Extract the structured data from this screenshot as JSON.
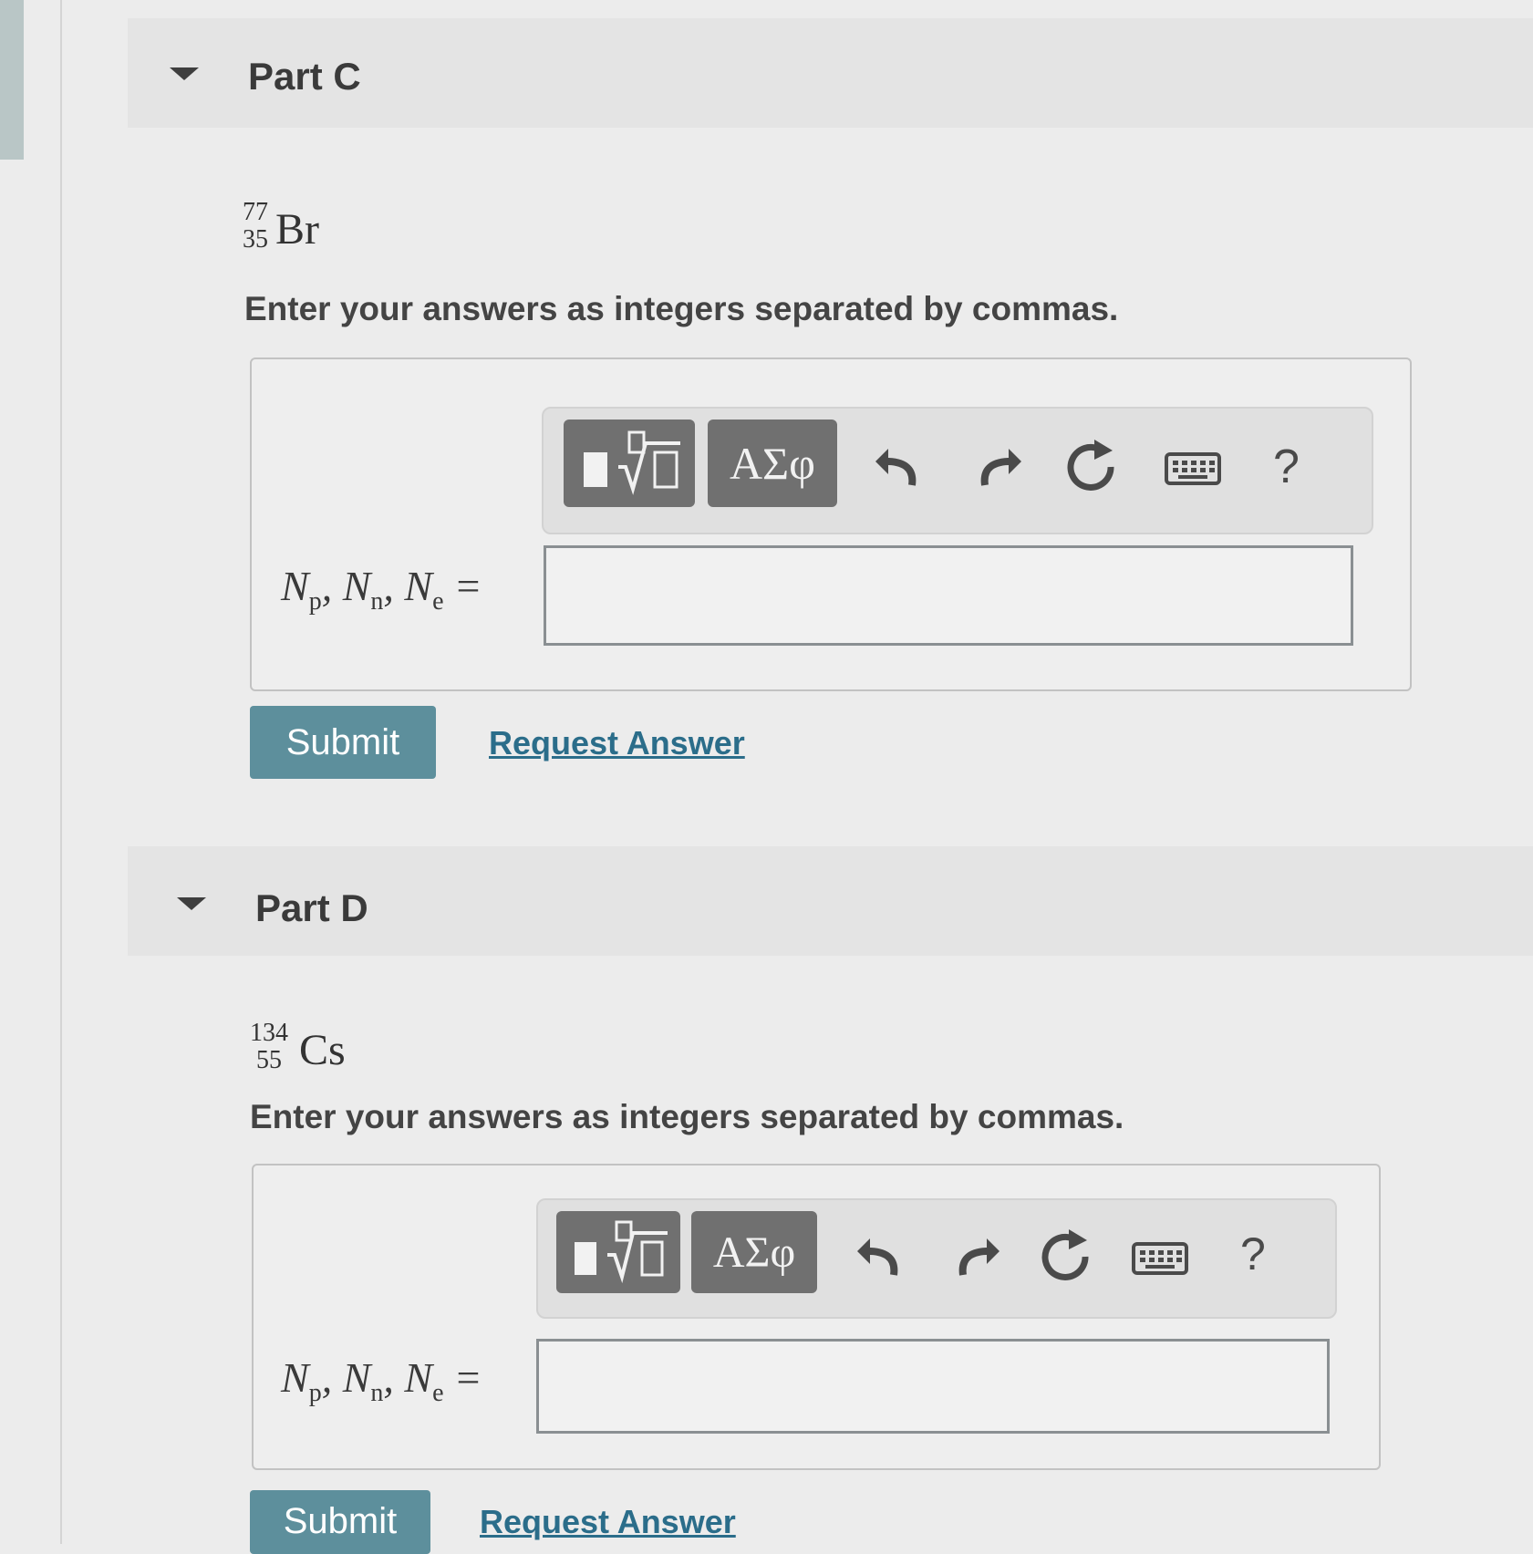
{
  "parts": [
    {
      "title": "Part C",
      "isotope": {
        "mass": "77",
        "atomic": "35",
        "symbol": "Br"
      },
      "instruction": "Enter your answers as integers separated by commas.",
      "toolbar": {
        "templates_icon": "templates-icon",
        "greek_label": "ΑΣφ",
        "help_label": "?"
      },
      "label": {
        "p": "p",
        "n": "n",
        "e": "e",
        "var": "N",
        "equals": "="
      },
      "input_value": "",
      "submit_label": "Submit",
      "request_label": "Request Answer"
    },
    {
      "title": "Part D",
      "isotope": {
        "mass": "134",
        "atomic": "55",
        "symbol": "Cs"
      },
      "instruction": "Enter your answers as integers separated by commas.",
      "toolbar": {
        "templates_icon": "templates-icon",
        "greek_label": "ΑΣφ",
        "help_label": "?"
      },
      "label": {
        "p": "p",
        "n": "n",
        "e": "e",
        "var": "N",
        "equals": "="
      },
      "input_value": "",
      "submit_label": "Submit",
      "request_label": "Request Answer"
    }
  ],
  "colors": {
    "accent": "#5d8f9c",
    "link": "#2b6d8a",
    "toolbar_button": "#707070"
  }
}
